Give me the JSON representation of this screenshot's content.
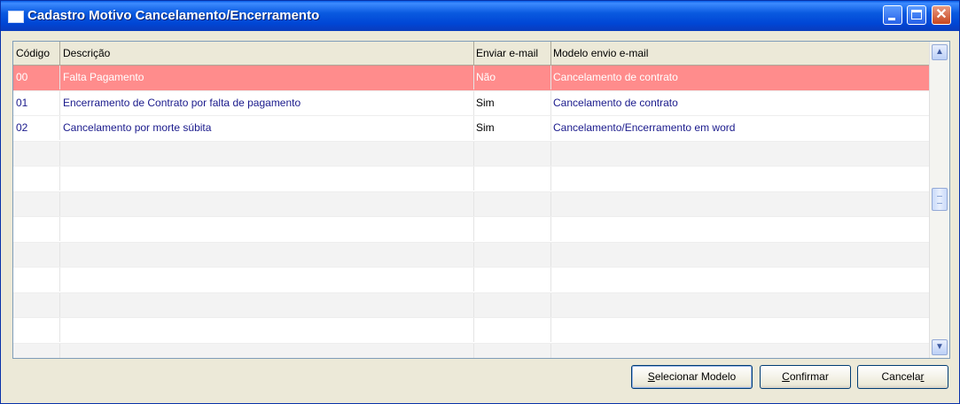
{
  "window": {
    "title": "Cadastro Motivo Cancelamento/Encerramento"
  },
  "grid": {
    "columns": [
      "Código",
      "Descrição",
      "Enviar e-mail",
      "Modelo envio e-mail"
    ],
    "rows": [
      {
        "codigo": "00",
        "descricao": "Falta Pagamento",
        "enviar": "Não",
        "modelo": "Cancelamento de contrato",
        "selected": true
      },
      {
        "codigo": "01",
        "descricao": "Encerramento de Contrato por falta de pagamento",
        "enviar": "Sim",
        "modelo": "Cancelamento de contrato",
        "selected": false
      },
      {
        "codigo": "02",
        "descricao": "Cancelamento por morte súbita",
        "enviar": "Sim",
        "modelo": "Cancelamento/Encerramento em word",
        "selected": false
      }
    ],
    "empty_rows": 9
  },
  "buttons": {
    "selecionar_first": "S",
    "selecionar_rest": "elecionar Modelo",
    "confirmar_first": "C",
    "confirmar_rest": "onfirmar",
    "cancelar_main": "Cancela",
    "cancelar_last": "r"
  },
  "colors": {
    "selected_row": "#ff8c8c",
    "text_blue": "#1a1a8c",
    "title_bar": "#0046d5"
  }
}
